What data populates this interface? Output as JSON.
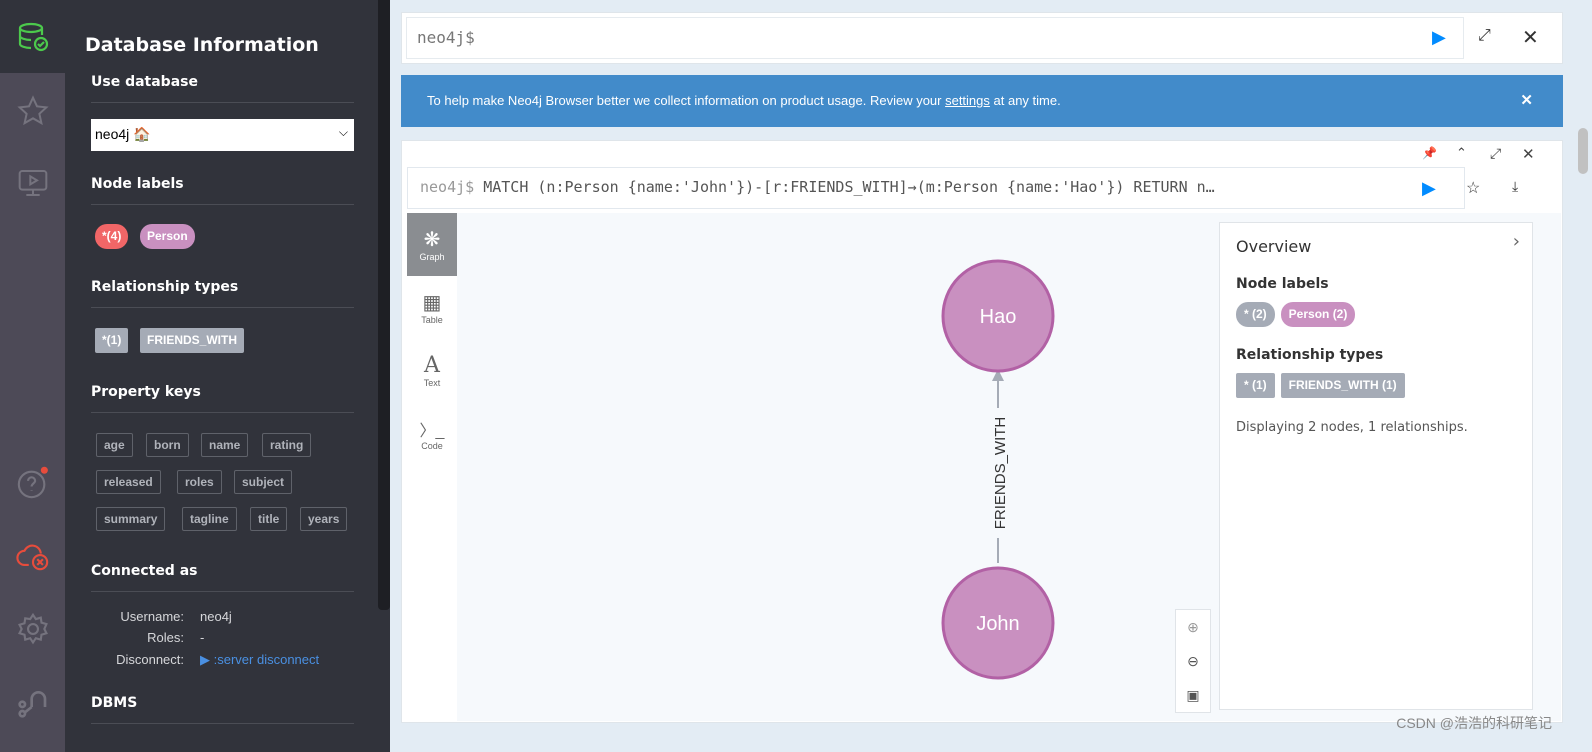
{
  "drawer": {
    "title": "Database Information",
    "use_database": "Use database",
    "db_selected": "neo4j 🏠",
    "node_labels_title": "Node labels",
    "node_labels": [
      "*(4)",
      "Person"
    ],
    "rel_types_title": "Relationship types",
    "rel_types": [
      "*(1)",
      "FRIENDS_WITH"
    ],
    "property_keys_title": "Property keys",
    "property_keys": [
      "age",
      "born",
      "name",
      "rating",
      "released",
      "roles",
      "subject",
      "summary",
      "tagline",
      "title",
      "years"
    ],
    "connected_title": "Connected as",
    "username_label": "Username:",
    "username": "neo4j",
    "roles_label": "Roles:",
    "roles": "-",
    "disconnect_label": "Disconnect:",
    "disconnect_link": ":server disconnect",
    "dbms_title": "DBMS"
  },
  "editor": {
    "prompt": "neo4j$"
  },
  "banner": {
    "text_before": "To help make Neo4j Browser better we collect information on product usage. Review your ",
    "link": "settings",
    "text_after": " at any time."
  },
  "frame": {
    "prompt": "neo4j$",
    "query": "MATCH (n:Person {name:'John'})-[r:FRIENDS_WITH]→(m:Person {name:'Hao'}) RETURN n…",
    "views": [
      "Graph",
      "Table",
      "Text",
      "Code"
    ],
    "graph": {
      "nodes": [
        "Hao",
        "John"
      ],
      "relationship": "FRIENDS_WITH"
    },
    "overview": {
      "title": "Overview",
      "node_labels_title": "Node labels",
      "node_labels": [
        "* (2)",
        "Person (2)"
      ],
      "rel_types_title": "Relationship types",
      "rel_types": [
        "* (1)",
        "FRIENDS_WITH (1)"
      ],
      "summary": "Displaying 2 nodes, 1 relationships."
    }
  },
  "watermark": "CSDN @浩浩的科研笔记",
  "colors": {
    "person": "#c990c0",
    "person_border": "#b261a5",
    "all": "#f16667",
    "rel": "#a5abb6",
    "accent": "#018bff",
    "banner": "#428bca"
  }
}
